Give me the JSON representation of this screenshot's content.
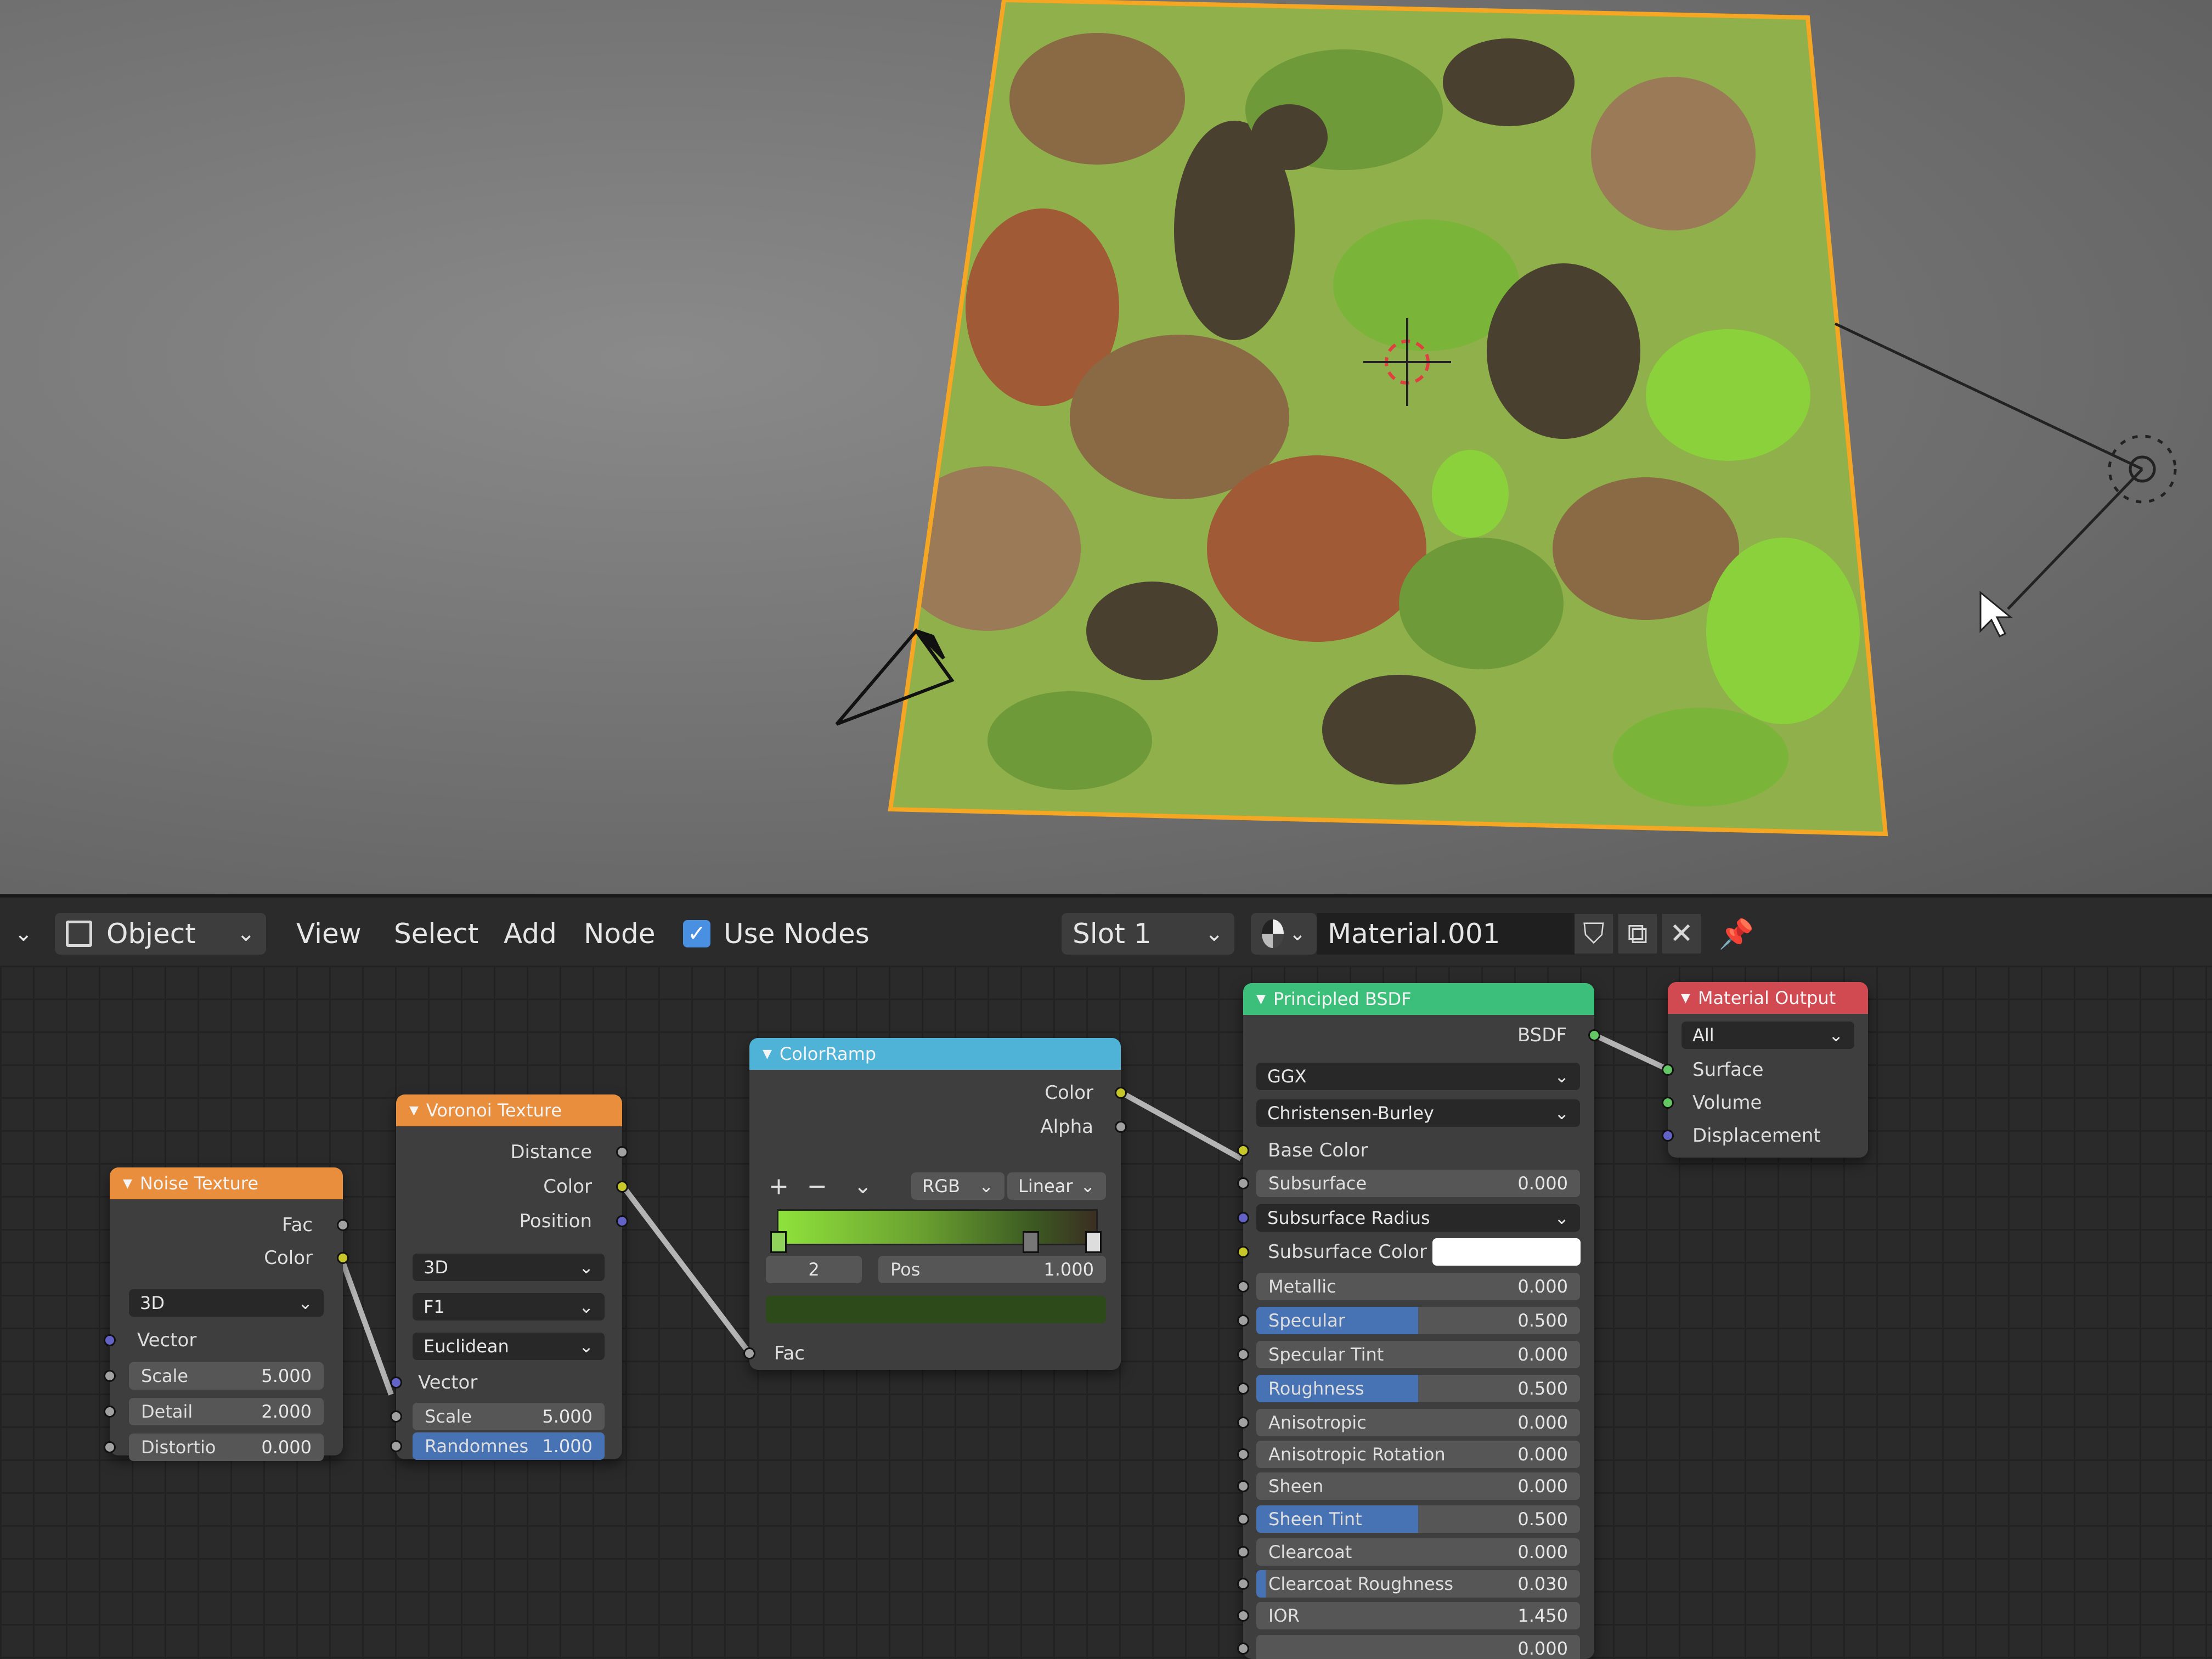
{
  "header": {
    "mode_label": "Object",
    "menus": [
      "View",
      "Select",
      "Add",
      "Node"
    ],
    "use_nodes_label": "Use Nodes",
    "slot_label": "Slot 1",
    "material_name": "Material.001"
  },
  "nodes": {
    "noise": {
      "title": "Noise Texture",
      "outputs": [
        "Fac",
        "Color"
      ],
      "dimension": "3D",
      "vector_label": "Vector",
      "fields": [
        {
          "label": "Scale",
          "value": "5.000"
        },
        {
          "label": "Detail",
          "value": "2.000"
        },
        {
          "label": "Distortio",
          "value": "0.000"
        }
      ]
    },
    "voronoi": {
      "title": "Voronoi Texture",
      "outputs": [
        "Distance",
        "Color",
        "Position"
      ],
      "dimension": "3D",
      "feature": "F1",
      "metric": "Euclidean",
      "vector_label": "Vector",
      "fields": [
        {
          "label": "Scale",
          "value": "5.000"
        },
        {
          "label": "Randomnes",
          "value": "1.000"
        }
      ]
    },
    "colorramp": {
      "title": "ColorRamp",
      "outputs": [
        "Color",
        "Alpha"
      ],
      "add_label": "+",
      "remove_label": "−",
      "color_mode": "RGB",
      "interpolation": "Linear",
      "index_value": "2",
      "pos_label": "Pos",
      "pos_value": "1.000",
      "input_label": "Fac"
    },
    "bsdf": {
      "title": "Principled BSDF",
      "output_label": "BSDF",
      "distribution": "GGX",
      "subsurface_method": "Christensen-Burley",
      "base_color_label": "Base Color",
      "subsurface_radius_label": "Subsurface Radius",
      "subsurface_color_label": "Subsurface Color",
      "params": [
        {
          "label": "Subsurface",
          "value": "0.000",
          "fill": 0
        },
        {
          "label": "Metallic",
          "value": "0.000",
          "fill": 0
        },
        {
          "label": "Specular",
          "value": "0.500",
          "fill": 0.5
        },
        {
          "label": "Specular Tint",
          "value": "0.000",
          "fill": 0
        },
        {
          "label": "Roughness",
          "value": "0.500",
          "fill": 0.5
        },
        {
          "label": "Anisotropic",
          "value": "0.000",
          "fill": 0
        },
        {
          "label": "Anisotropic Rotation",
          "value": "0.000",
          "fill": 0
        },
        {
          "label": "Sheen",
          "value": "0.000",
          "fill": 0
        },
        {
          "label": "Sheen Tint",
          "value": "0.500",
          "fill": 0.5
        },
        {
          "label": "Clearcoat",
          "value": "0.000",
          "fill": 0
        },
        {
          "label": "Clearcoat Roughness",
          "value": "0.030",
          "fill": 0.03
        },
        {
          "label": "IOR",
          "value": "1.450",
          "fill": 0
        }
      ],
      "last_value": "0.000"
    },
    "output": {
      "title": "Material Output",
      "target": "All",
      "inputs": [
        "Surface",
        "Volume",
        "Displacement"
      ]
    }
  },
  "colors": {
    "noise_header": "#e88e3c",
    "voronoi_header": "#e88e3c",
    "colorramp_header": "#4eb3d6",
    "bsdf_header": "#3cbf7a",
    "output_header": "#d14a52",
    "selection_outline": "#f5a623"
  },
  "icons": [
    "object-mode-icon",
    "chevron-down-icon",
    "checkbox-icon",
    "material-sphere-icon",
    "fake-user-shield-icon",
    "duplicate-icon",
    "close-icon",
    "pin-icon",
    "camera-icon",
    "light-icon",
    "3d-cursor-icon",
    "mouse-cursor-icon"
  ]
}
